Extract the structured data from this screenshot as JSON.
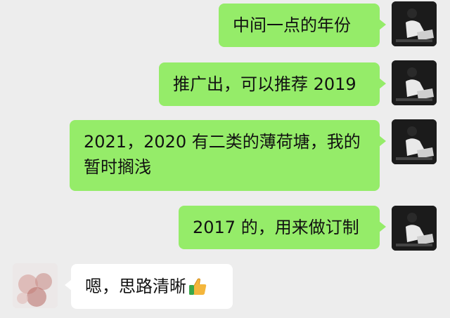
{
  "messages": [
    {
      "side": "right",
      "text": "中间一点的年份"
    },
    {
      "side": "right",
      "text": "推广出，可以推荐 2019"
    },
    {
      "side": "right",
      "text": "2021，2020 有二类的薄荷塘，我的暂时搁浅"
    },
    {
      "side": "right",
      "text": "2017 的，用来做订制"
    },
    {
      "side": "left",
      "text": "嗯，思路清晰",
      "emoji": "thumbs-up-icon"
    }
  ],
  "colors": {
    "background": "#ededed",
    "outgoing_bubble": "#95ec69",
    "incoming_bubble": "#ffffff"
  }
}
